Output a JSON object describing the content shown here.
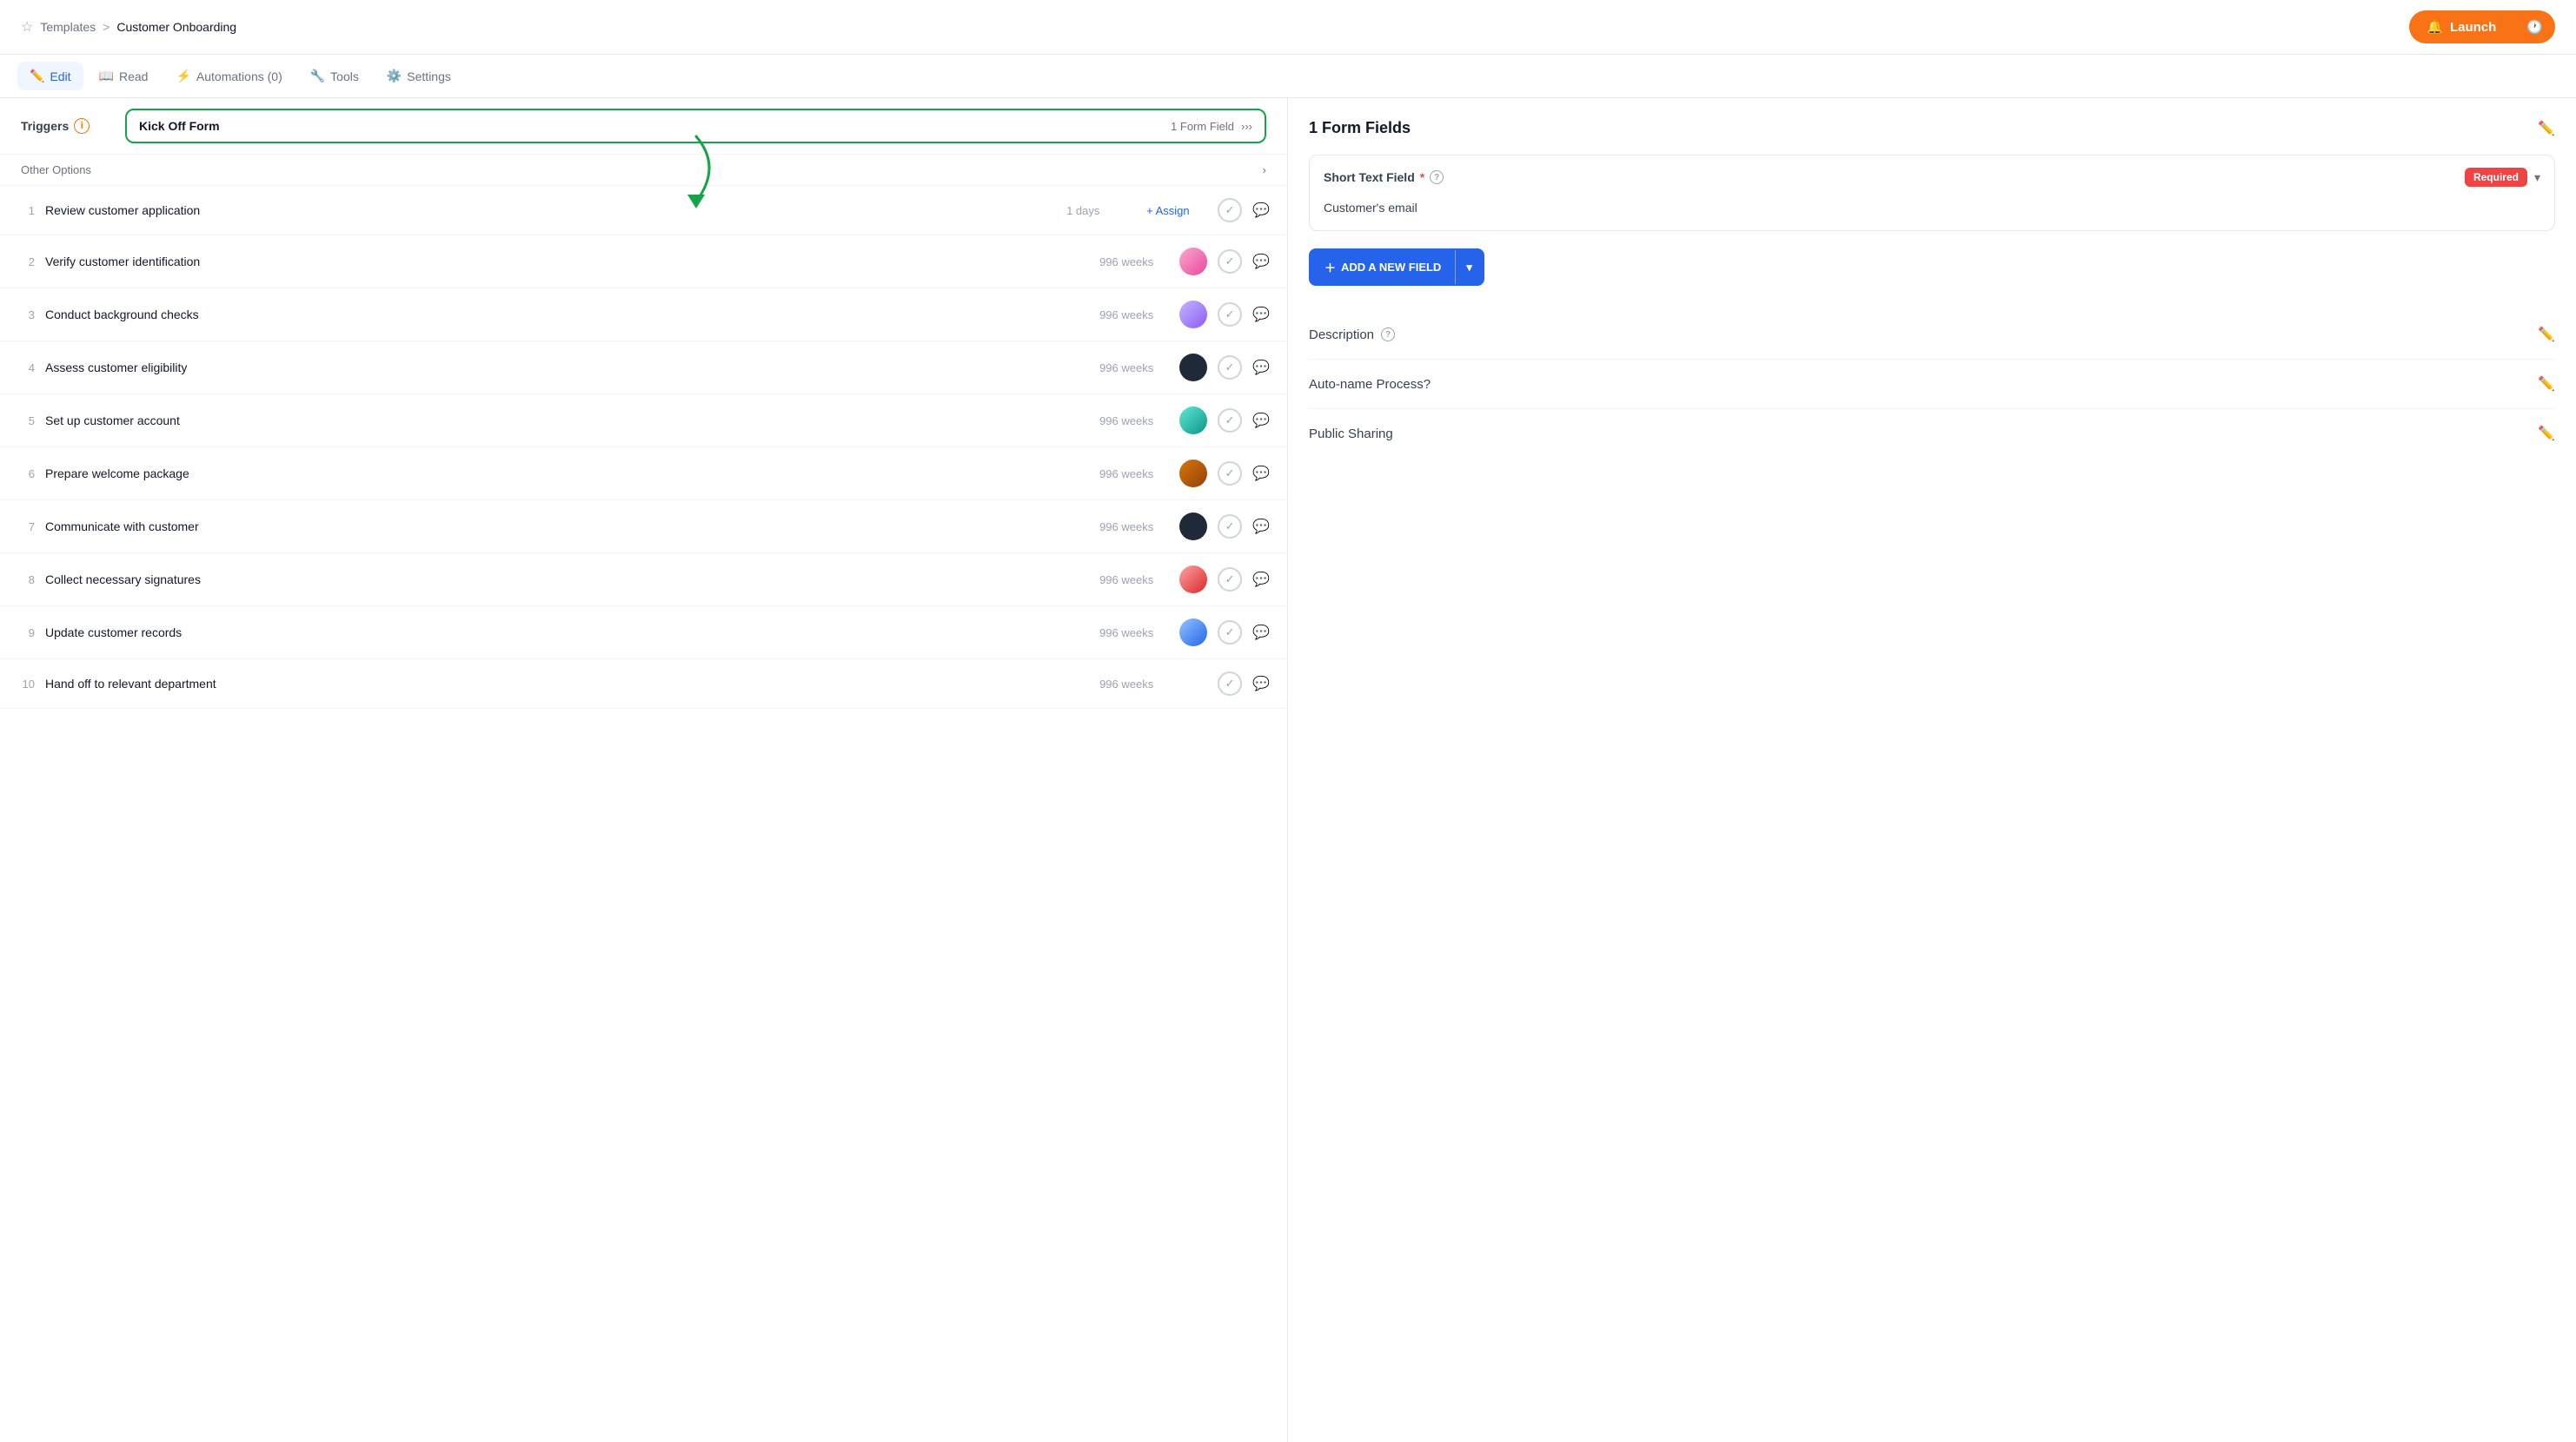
{
  "header": {
    "breadcrumb_parent": "Templates",
    "breadcrumb_sep": ">",
    "breadcrumb_current": "Customer Onboarding",
    "launch_label": "Launch"
  },
  "tabs": [
    {
      "id": "edit",
      "label": "Edit",
      "active": true,
      "icon": "✏️"
    },
    {
      "id": "read",
      "label": "Read",
      "active": false,
      "icon": "📖"
    },
    {
      "id": "automations",
      "label": "Automations (0)",
      "active": false,
      "icon": "⚡"
    },
    {
      "id": "tools",
      "label": "Tools",
      "active": false,
      "icon": "🔧"
    },
    {
      "id": "settings",
      "label": "Settings",
      "active": false,
      "icon": "⚙️"
    }
  ],
  "left": {
    "triggers_label": "Triggers",
    "kickoff_label": "Kick Off Form",
    "kickoff_fields": "1 Form Field",
    "other_options": "Other Options",
    "tasks": [
      {
        "num": 1,
        "name": "Review customer application",
        "duration": "1 days",
        "has_assign": true,
        "assign_label": "+ Assign",
        "avatar": null,
        "avatar_class": null
      },
      {
        "num": 2,
        "name": "Verify customer identification",
        "duration": "996 weeks",
        "has_assign": false,
        "avatar_class": "av-pink"
      },
      {
        "num": 3,
        "name": "Conduct background checks",
        "duration": "996 weeks",
        "has_assign": false,
        "avatar_class": "av-purple"
      },
      {
        "num": 4,
        "name": "Assess customer eligibility",
        "duration": "996 weeks",
        "has_assign": false,
        "avatar_class": "av-dark"
      },
      {
        "num": 5,
        "name": "Set up customer account",
        "duration": "996 weeks",
        "has_assign": false,
        "avatar_class": "av-teal"
      },
      {
        "num": 6,
        "name": "Prepare welcome package",
        "duration": "996 weeks",
        "has_assign": false,
        "avatar_class": "av-brown"
      },
      {
        "num": 7,
        "name": "Communicate with customer",
        "duration": "996 weeks",
        "has_assign": false,
        "avatar_class": "av-dark"
      },
      {
        "num": 8,
        "name": "Collect necessary signatures",
        "duration": "996 weeks",
        "has_assign": false,
        "avatar_class": "av-warm"
      },
      {
        "num": 9,
        "name": "Update customer records",
        "duration": "996 weeks",
        "has_assign": false,
        "avatar_class": "av-blue"
      },
      {
        "num": 10,
        "name": "Hand off to relevant department",
        "duration": "996 weeks",
        "has_assign": false,
        "avatar": null,
        "avatar_class": null
      }
    ]
  },
  "right": {
    "title": "1 Form Fields",
    "field_type": "Short Text Field",
    "required_label": "Required",
    "field_value": "Customer's email",
    "add_field_label": "ADD A NEW FIELD",
    "description_label": "Description",
    "auto_name_label": "Auto-name Process?",
    "public_sharing_label": "Public Sharing"
  }
}
